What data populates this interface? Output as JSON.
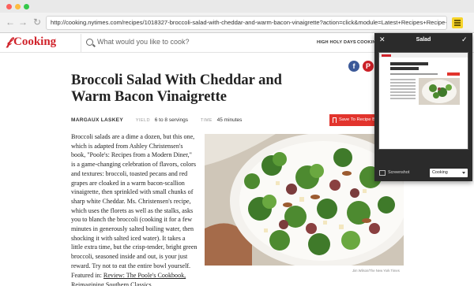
{
  "browser": {
    "url": "http://cooking.nytimes.com/recipes/1018327-broccoli-salad-with-cheddar-and-warm-bacon-vinaigrette?action=click&module=Latest+Recipes+Recipe+Card&region=all&pg..."
  },
  "site": {
    "logo_text": "Cooking",
    "search_placeholder": "What would you like to cook?",
    "nav": [
      "HIGH HOLY DAYS",
      "COOKING"
    ]
  },
  "recipe": {
    "title": "Broccoli Salad With Cheddar and Warm Bacon Vinaigrette",
    "author": "MARGAUX LASKEY",
    "yield_label": "YIELD",
    "yield_value": "6 to 8 servings",
    "time_label": "TIME",
    "time_value": "45 minutes",
    "save_label": "Save To Recipe B",
    "intro": "Broccoli salads are a dime a dozen, but this one, which is adapted from Ashley Christensen's book, \"Poole's: Recipes from a Modern Diner,\" is a game-changing celebration of flavors, colors and textures: broccoli, toasted pecans and red grapes are cloaked in a warm bacon-scallion vinaigrette, then sprinkled with small chunks of sharp white Cheddar. Ms. Christensen's recipe, which uses the florets as well as the stalks, asks you to blanch the broccoli (cooking it for a few minutes in generously salted boiling water, then shocking it with salted iced water). It takes a little extra time, but the crisp-tender, bright green broccoli, seasoned inside and out, is your just reward. Try not to eat the entire bowl yourself.",
    "featured_prefix": "Featured in: ",
    "featured_link": "Review: The Poole's Cookbook, Reimagining Southern Classics",
    "photo_credit": "Jim Wilson/The New York Times"
  },
  "share_panel": {
    "title": "Salad",
    "screenshot_label": "Screenshot",
    "destination": "Cooking"
  },
  "colors": {
    "brand_red": "#d0232b",
    "save_red": "#e2342d",
    "panel_bg": "#2b2b2b"
  }
}
